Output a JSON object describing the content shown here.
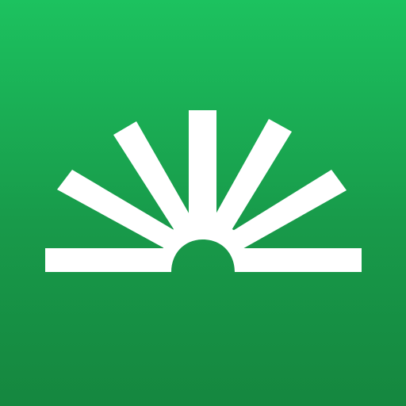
{
  "app_icon": {
    "name": "sunrise-logo-icon",
    "colors": {
      "background_top": "#1cc25f",
      "background_bottom": "#15873f",
      "mark": "#ffffff"
    }
  }
}
